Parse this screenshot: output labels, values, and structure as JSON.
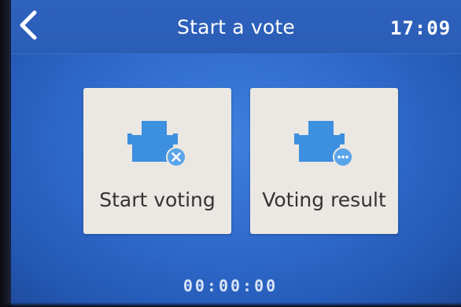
{
  "header": {
    "back_icon": "chevron-left-icon",
    "title": "Start a vote",
    "time": "17:09"
  },
  "tiles": [
    {
      "label": "Start voting",
      "icon": "ballot-box-cancel-icon"
    },
    {
      "label": "Voting result",
      "icon": "ballot-box-more-icon"
    }
  ],
  "footer": {
    "timer": "00:00:00"
  },
  "colors": {
    "background": "#2f6bcd",
    "tile": "#ebe7e2",
    "icon": "#3d8fe0",
    "text_dark": "#333333",
    "text_light": "#ffffff"
  }
}
